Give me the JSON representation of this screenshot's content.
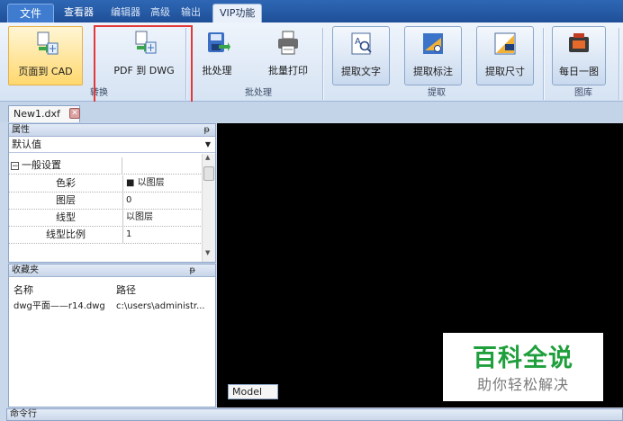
{
  "ribbon_tabs": [
    {
      "label": "文件"
    },
    {
      "label": "查看器"
    },
    {
      "label": "编辑器"
    },
    {
      "label": "高级"
    },
    {
      "label": "输出"
    },
    {
      "label": "VIP功能"
    }
  ],
  "ribbon_buttons": [
    {
      "label": "页面到 CAD"
    },
    {
      "label": "PDF 到 DWG"
    },
    {
      "label": "批处理"
    },
    {
      "label": "批量打印"
    },
    {
      "label": "提取文字"
    },
    {
      "label": "提取标注"
    },
    {
      "label": "提取尺寸"
    },
    {
      "label": "每日一图"
    }
  ],
  "ribbon_groups": [
    {
      "label": "转换"
    },
    {
      "label": "批处理"
    },
    {
      "label": "提取"
    },
    {
      "label": "图库"
    }
  ],
  "document_tab": {
    "label": "New1.dxf",
    "close_glyph": "✕"
  },
  "properties": {
    "title": "属性",
    "pin_glyph": "ᵽ",
    "selected": "默认值",
    "group": "一般设置",
    "collapse_glyph": "−",
    "rows": [
      {
        "key": "色彩",
        "value": "■ 以图层"
      },
      {
        "key": "图层",
        "value": "0"
      },
      {
        "key": "线型",
        "value": "以图层"
      },
      {
        "key": "线型比例",
        "value": "1"
      }
    ]
  },
  "favorites": {
    "title": "收藏夹",
    "pin_glyph": "ᵽ",
    "columns": [
      "名称",
      "路径"
    ],
    "rows": [
      {
        "name": "dwg平面——r14.dwg",
        "path": "c:\\users\\administr..."
      }
    ]
  },
  "model_tab": {
    "label": "Model"
  },
  "watermark": {
    "title": "百科全说",
    "subtitle": "助你轻松解决",
    "color": "#1f9f3c"
  },
  "command_line": {
    "label": "命令行"
  },
  "colors": {
    "ribbon_tab_bar": "#2e67b5",
    "highlight": "#e23a3a",
    "canvas": "#000000"
  }
}
